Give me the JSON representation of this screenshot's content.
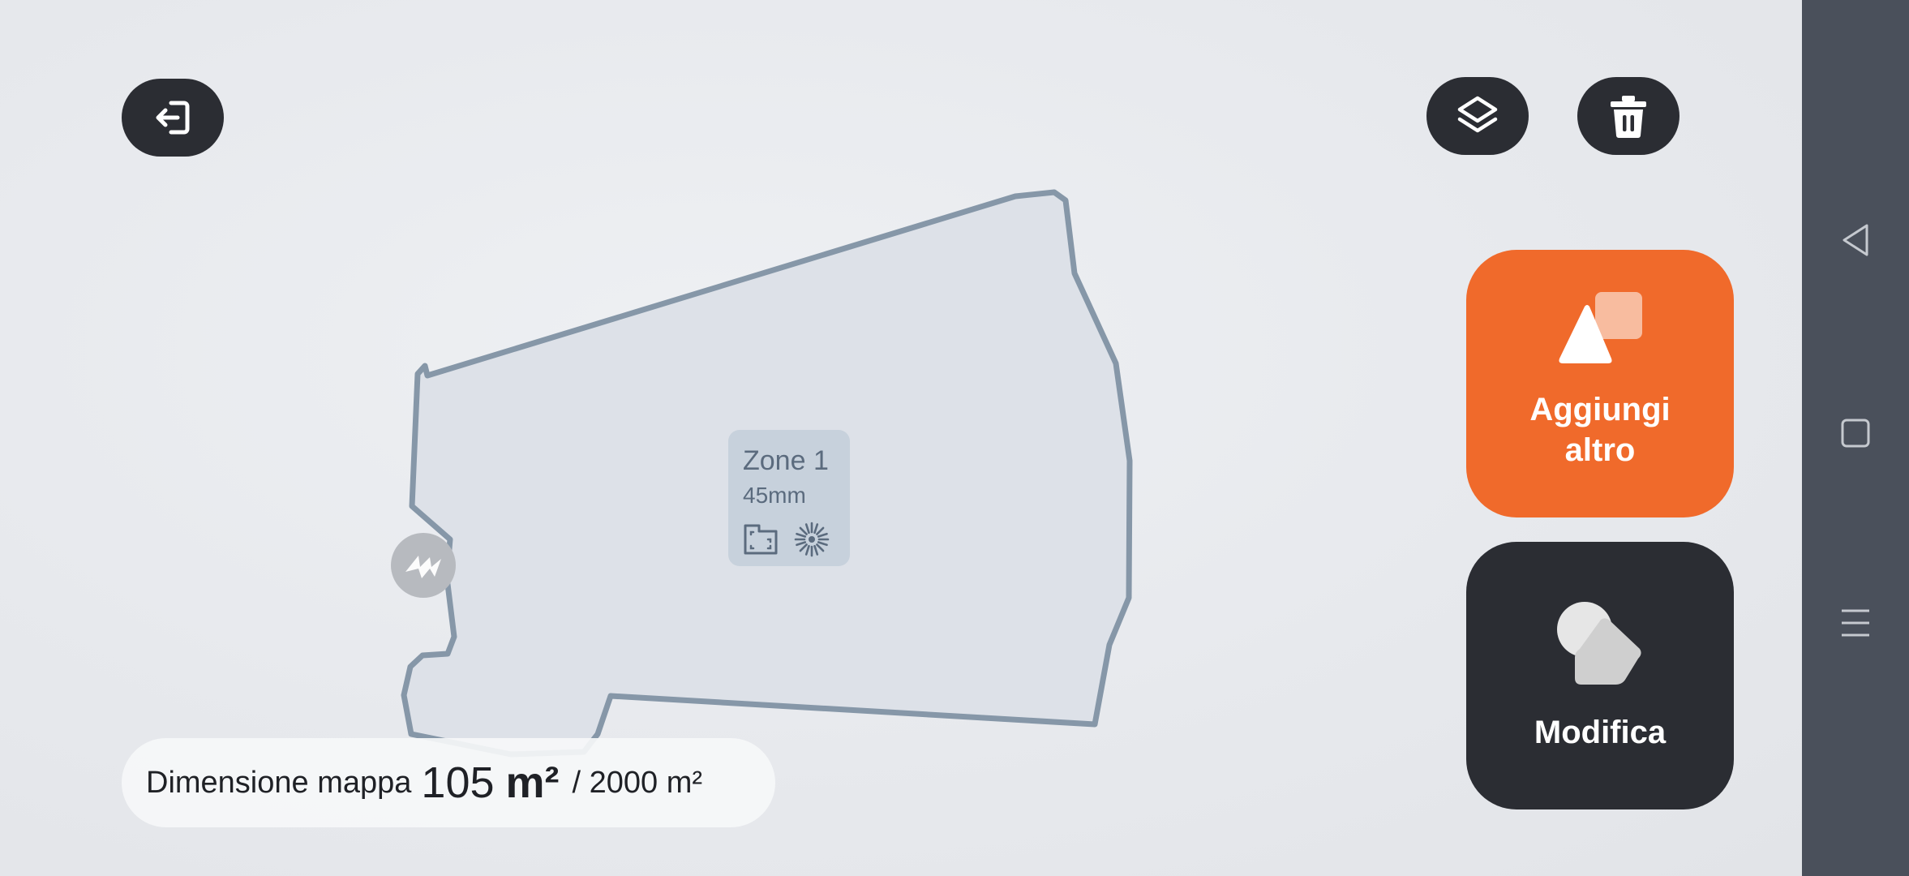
{
  "header": {
    "exit_icon": "exit-icon",
    "layers_icon": "layers-icon",
    "delete_icon": "trash-icon"
  },
  "map": {
    "zone": {
      "name": "Zone 1",
      "cut_height": "45mm",
      "icons": [
        "map-zone-icon",
        "mowing-pattern-icon"
      ]
    },
    "dock_icon": "charging-dock-icon",
    "size": {
      "label": "Dimensione mappa",
      "value": "105",
      "unit": "m²",
      "limit": "/ 2000 m²"
    }
  },
  "actions": {
    "add_label_line1": "Aggiungi",
    "add_label_line2": "altro",
    "edit_label": "Modifica"
  },
  "system_nav": {
    "back_icon": "back-triangle-icon",
    "home_icon": "home-square-icon",
    "menu_icon": "menu-lines-icon"
  },
  "colors": {
    "accent": "#f06a2b",
    "dark_button": "#2b2d33",
    "zone_border": "#8697a8",
    "zone_fill": "#dde1e8",
    "nav_bar": "#4a505b"
  }
}
